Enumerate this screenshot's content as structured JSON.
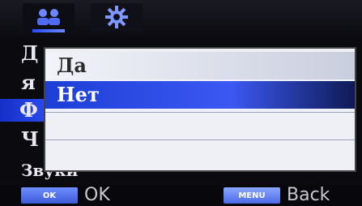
{
  "tabs": [
    {
      "icon": "people-icon"
    },
    {
      "icon": "gear-icon"
    }
  ],
  "settings_list": {
    "items": [
      "Д",
      "я",
      "Ф",
      "Ч"
    ],
    "selected_index": 2,
    "bottom_item": "Звуки"
  },
  "dialog": {
    "options": [
      "Да",
      "Нет"
    ],
    "selected": "Нет"
  },
  "hints": {
    "ok_button": "OK",
    "ok_label": "OK",
    "menu_button": "MENU",
    "back_label": "Back"
  },
  "colors": {
    "accent": "#2a4cff",
    "selection": "#1d3fd6",
    "background": "#0a0a0f"
  }
}
